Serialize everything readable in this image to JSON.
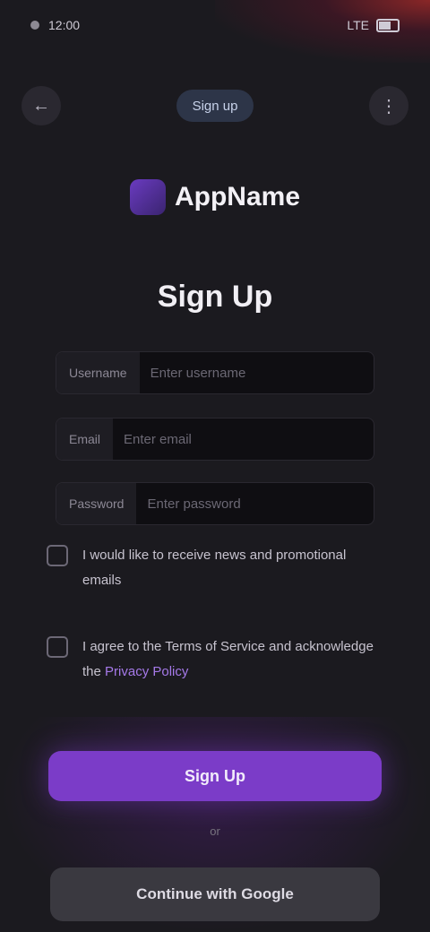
{
  "status_bar": {
    "time": "12:00",
    "carrier": "LTE"
  },
  "header": {
    "title": "Sign up",
    "back_icon": "arrow-left-icon",
    "menu_icon": "more-icon"
  },
  "brand": {
    "name": "AppName",
    "accent_color": "#7b3cc8"
  },
  "page": {
    "title": "Sign Up"
  },
  "form": {
    "fields": [
      {
        "label": "Username",
        "placeholder": "Enter username"
      },
      {
        "label": "Email",
        "placeholder": "Enter email"
      },
      {
        "label": "Password",
        "placeholder": "Enter password"
      }
    ],
    "check1_text": "I would like to receive news and promotional emails",
    "check2_text_prefix": "I agree to the Terms of Service and acknowledge the ",
    "check2_link": "Privacy Policy"
  },
  "actions": {
    "primary_label": "Sign Up",
    "divider_label": "or",
    "secondary_label": "Continue with Google"
  }
}
